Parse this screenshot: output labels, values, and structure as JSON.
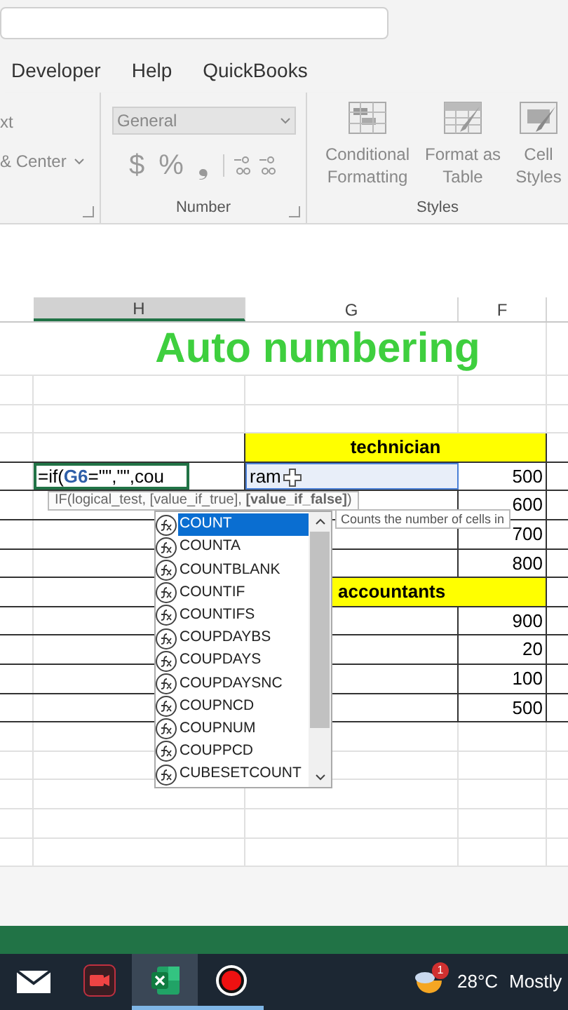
{
  "tabs": [
    {
      "label": "Developer",
      "selected": false
    },
    {
      "label": "Help",
      "selected": false
    },
    {
      "label": "QuickBooks",
      "selected": false
    }
  ],
  "ribbon": {
    "alignment_partial": [
      "xt",
      "& Center"
    ],
    "number_format": "General",
    "number_buttons": [
      "$",
      "%",
      "❟"
    ],
    "number_label": "Number",
    "styles": [
      {
        "label": "Conditional Formatting",
        "kind": "conditional"
      },
      {
        "label": "Format as Table",
        "kind": "table"
      },
      {
        "label": "Cell Styles",
        "kind": "cell"
      }
    ],
    "styles_label": "Styles"
  },
  "columns": [
    {
      "label": "H",
      "selected": true
    },
    {
      "label": "G",
      "selected": false
    },
    {
      "label": "F",
      "selected": false
    }
  ],
  "rows": [
    {
      "kind": "title",
      "text": "Auto numbering"
    },
    {
      "kind": "blank"
    },
    {
      "kind": "blank"
    },
    {
      "kind": "header",
      "text": "technician",
      "centered": true
    },
    {
      "kind": "edit",
      "formula": [
        {
          "text": "=if(",
          "kind": "plain"
        },
        {
          "text": "G6",
          "kind": "ref"
        },
        {
          "text": "=\"\",\"\",cou",
          "kind": "plain"
        }
      ],
      "g": "ram",
      "f": "500"
    },
    {
      "kind": "data",
      "f": "600"
    },
    {
      "kind": "data",
      "f": "700"
    },
    {
      "kind": "data",
      "f": "800"
    },
    {
      "kind": "header",
      "text": "accountants",
      "centered": false
    },
    {
      "kind": "data",
      "f": "900"
    },
    {
      "kind": "data",
      "f": "20"
    },
    {
      "kind": "data",
      "f": "100"
    },
    {
      "kind": "data",
      "f": "500"
    },
    {
      "kind": "blank"
    },
    {
      "kind": "blank"
    },
    {
      "kind": "blank"
    },
    {
      "kind": "blank"
    },
    {
      "kind": "blank"
    }
  ],
  "arg_tooltip": "IF(logical_test, [value_if_true], **[value_if_false]**)",
  "suggestions": [
    {
      "label": "COUNT",
      "selected": true
    },
    {
      "label": "COUNTA",
      "selected": false
    },
    {
      "label": "COUNTBLANK",
      "selected": false
    },
    {
      "label": "COUNTIF",
      "selected": false
    },
    {
      "label": "COUNTIFS",
      "selected": false
    },
    {
      "label": "COUPDAYBS",
      "selected": false
    },
    {
      "label": "COUPDAYS",
      "selected": false
    },
    {
      "label": "COUPDAYSNC",
      "selected": false
    },
    {
      "label": "COUPNCD",
      "selected": false
    },
    {
      "label": "COUPNUM",
      "selected": false
    },
    {
      "label": "COUPPCD",
      "selected": false
    },
    {
      "label": "CUBESETCOUNT",
      "selected": false
    }
  ],
  "description_tooltip": "Counts the number of cells in",
  "taskbar": {
    "apps": [
      {
        "kind": "mail",
        "selected": false,
        "running": false
      },
      {
        "kind": "recorder",
        "selected": false,
        "running": false
      },
      {
        "kind": "excel",
        "selected": true,
        "running": true
      },
      {
        "kind": "record",
        "selected": false,
        "running": true
      }
    ],
    "weather_badge": "1",
    "temperature": "28°C",
    "condition": "Mostly"
  }
}
